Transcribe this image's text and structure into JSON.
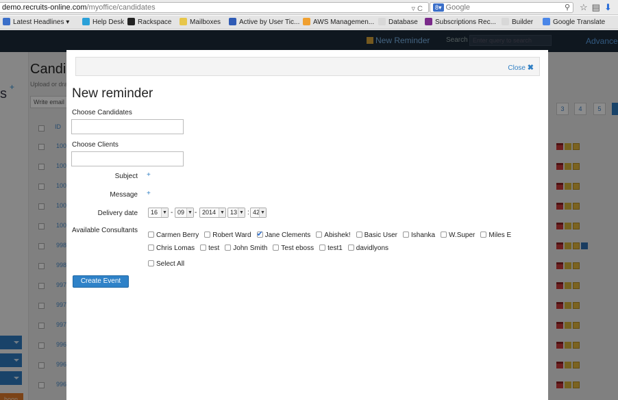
{
  "browser": {
    "url_domain": "demo.recruits-online.com",
    "url_path": "/myoffice/candidates",
    "search_engine_label": "Google",
    "bookmarks": [
      {
        "label": "Latest Headlines ▾",
        "color": "#3b6fc9"
      },
      {
        "label": "Help Desk",
        "color": "#2aa0d8"
      },
      {
        "label": "Rackspace",
        "color": "#222222"
      },
      {
        "label": "Mailboxes",
        "color": "#e7c64a"
      },
      {
        "label": "Active by User Tic...",
        "color": "#2f5bb5"
      },
      {
        "label": "AWS Managemen...",
        "color": "#f0a030"
      },
      {
        "label": "Database",
        "color": "#d8d8d8"
      },
      {
        "label": "Subscriptions Rec...",
        "color": "#7a2a8a"
      },
      {
        "label": "Builder",
        "color": "#d8d8d8"
      },
      {
        "label": "Google Translate",
        "color": "#4a86e8"
      }
    ]
  },
  "app": {
    "new_reminder_label": "New Reminder",
    "search_label": "Search",
    "search_placeholder": "Enter query to search",
    "advance_label": "Advance",
    "page_title": "Candid",
    "page_subtitle": "Upload or dra",
    "write_email_label": "Write email",
    "id_header": "ID",
    "row_ids": [
      "100",
      "100",
      "100",
      "100",
      "100",
      "998",
      "998",
      "997",
      "997",
      "997",
      "996",
      "996",
      "996"
    ],
    "pager": [
      "3",
      "4",
      "5"
    ],
    "left_orange_label": "hoon"
  },
  "modal": {
    "close_label": "Close",
    "title": "New reminder",
    "choose_candidates_label": "Choose Candidates",
    "choose_clients_label": "Choose Clients",
    "subject_label": "Subject",
    "message_label": "Message",
    "delivery_date_label": "Delivery date",
    "delivery_date": {
      "day": "16",
      "month": "09",
      "year": "2014",
      "hour": "13",
      "minute": "42"
    },
    "available_consultants_label": "Available Consultants",
    "consultants_row1": [
      {
        "name": "Carmen Berry",
        "checked": false
      },
      {
        "name": "Robert Ward",
        "checked": false
      },
      {
        "name": "Jane Clements",
        "checked": true
      },
      {
        "name": "Abishek!",
        "checked": false
      },
      {
        "name": "Basic User",
        "checked": false
      },
      {
        "name": "Ishanka",
        "checked": false
      },
      {
        "name": "W.Super",
        "checked": false
      },
      {
        "name": "Miles E",
        "checked": false
      }
    ],
    "consultants_row2": [
      {
        "name": "Chris Lomas",
        "checked": false
      },
      {
        "name": "test",
        "checked": false
      },
      {
        "name": "John Smith",
        "checked": false
      },
      {
        "name": "Test eboss",
        "checked": false
      },
      {
        "name": "test1",
        "checked": false
      },
      {
        "name": "davidlyons",
        "checked": false
      }
    ],
    "select_all_label": "Select All",
    "create_event_label": "Create Event"
  }
}
